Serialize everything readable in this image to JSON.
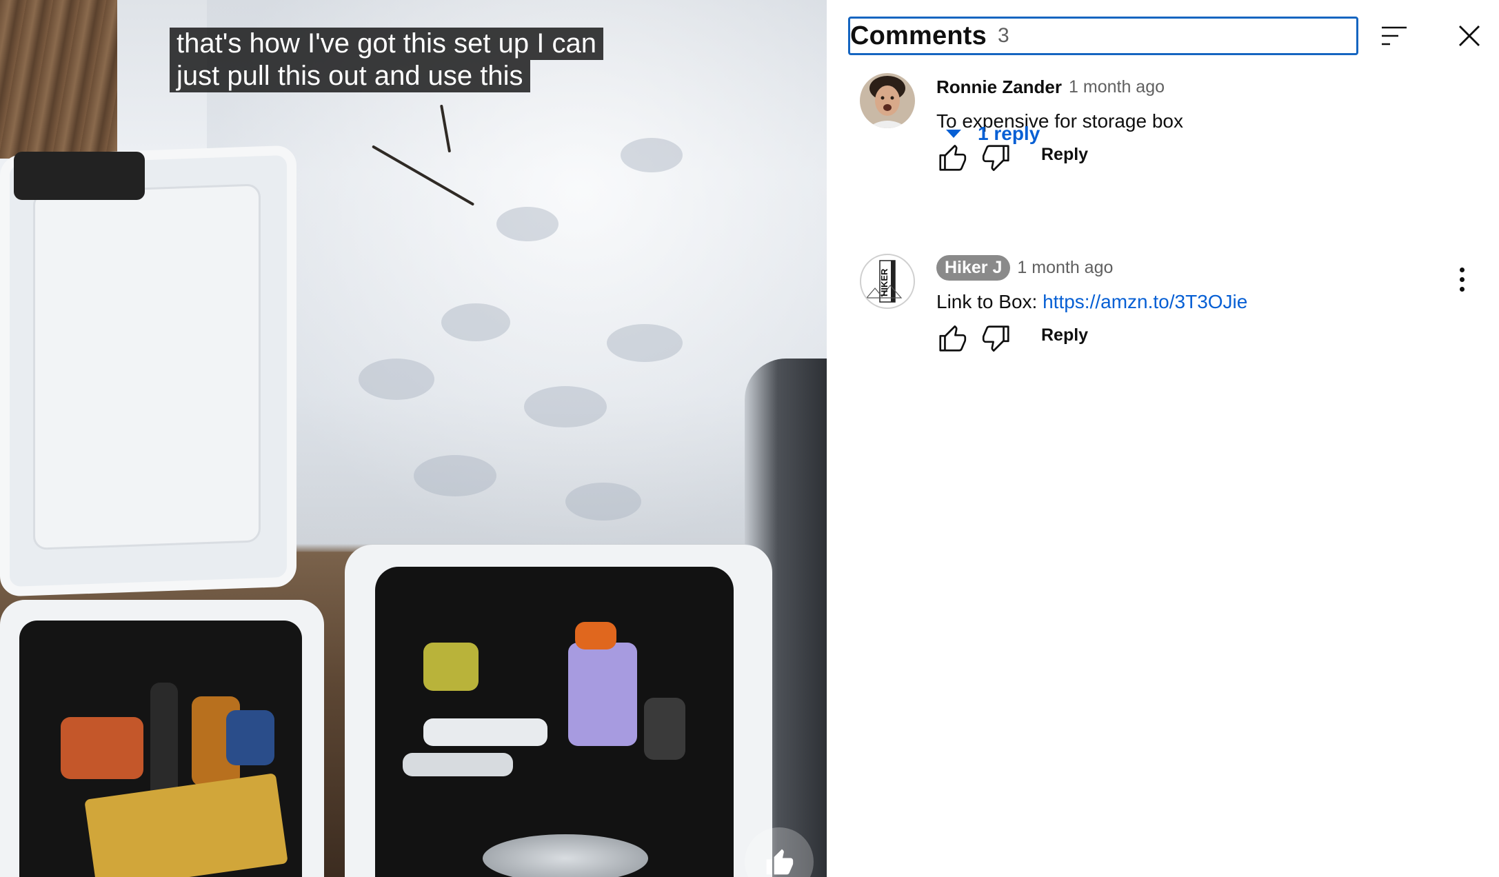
{
  "video": {
    "caption_lines": [
      "that's how I've got this set up I can",
      "just pull this out and use this"
    ]
  },
  "comments_panel": {
    "title": "Comments",
    "count": "3",
    "comments": [
      {
        "author": "Ronnie Zander",
        "time": "1 month ago",
        "text": "To expensive for storage box",
        "reply_label": "Reply",
        "replies_label": "1 reply"
      },
      {
        "author": "Hiker J",
        "time": "1 month ago",
        "text_prefix": "Link to Box: ",
        "link": "https://amzn.to/3T3OJie",
        "reply_label": "Reply",
        "avatar_text": "HIKER"
      }
    ]
  },
  "colors": {
    "accent": "#065fd4",
    "focus_border": "#1565c0",
    "caption_bg": "#080808"
  },
  "icons": [
    "sort-icon",
    "close-icon",
    "thumbs-up-icon",
    "thumbs-down-icon",
    "chevron-down-icon",
    "more-vert-icon"
  ]
}
